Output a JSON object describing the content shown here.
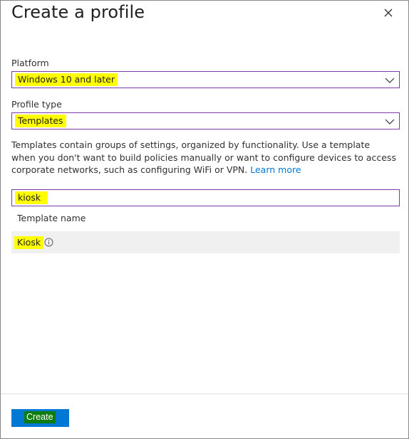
{
  "dialog": {
    "title": "Create a profile",
    "close_icon": "close-icon"
  },
  "platform": {
    "label": "Platform",
    "value": "Windows 10 and later"
  },
  "profile_type": {
    "label": "Profile type",
    "value": "Templates"
  },
  "description": {
    "text": "Templates contain groups of settings, organized by functionality. Use a template when you don't want to build policies manually or want to configure devices to access corporate networks, such as configuring WiFi or VPN.",
    "link": "Learn more"
  },
  "search": {
    "value": "kiosk"
  },
  "template_table": {
    "column_header": "Template name",
    "rows": [
      {
        "name": "Kiosk",
        "icon": "info-icon"
      }
    ]
  },
  "footer": {
    "create_label": "Create"
  },
  "colors": {
    "accent": "#0078d4",
    "highlight": "#ffff00",
    "button_text_highlight": "#107c10",
    "focus_border": "#7a3aa8"
  }
}
